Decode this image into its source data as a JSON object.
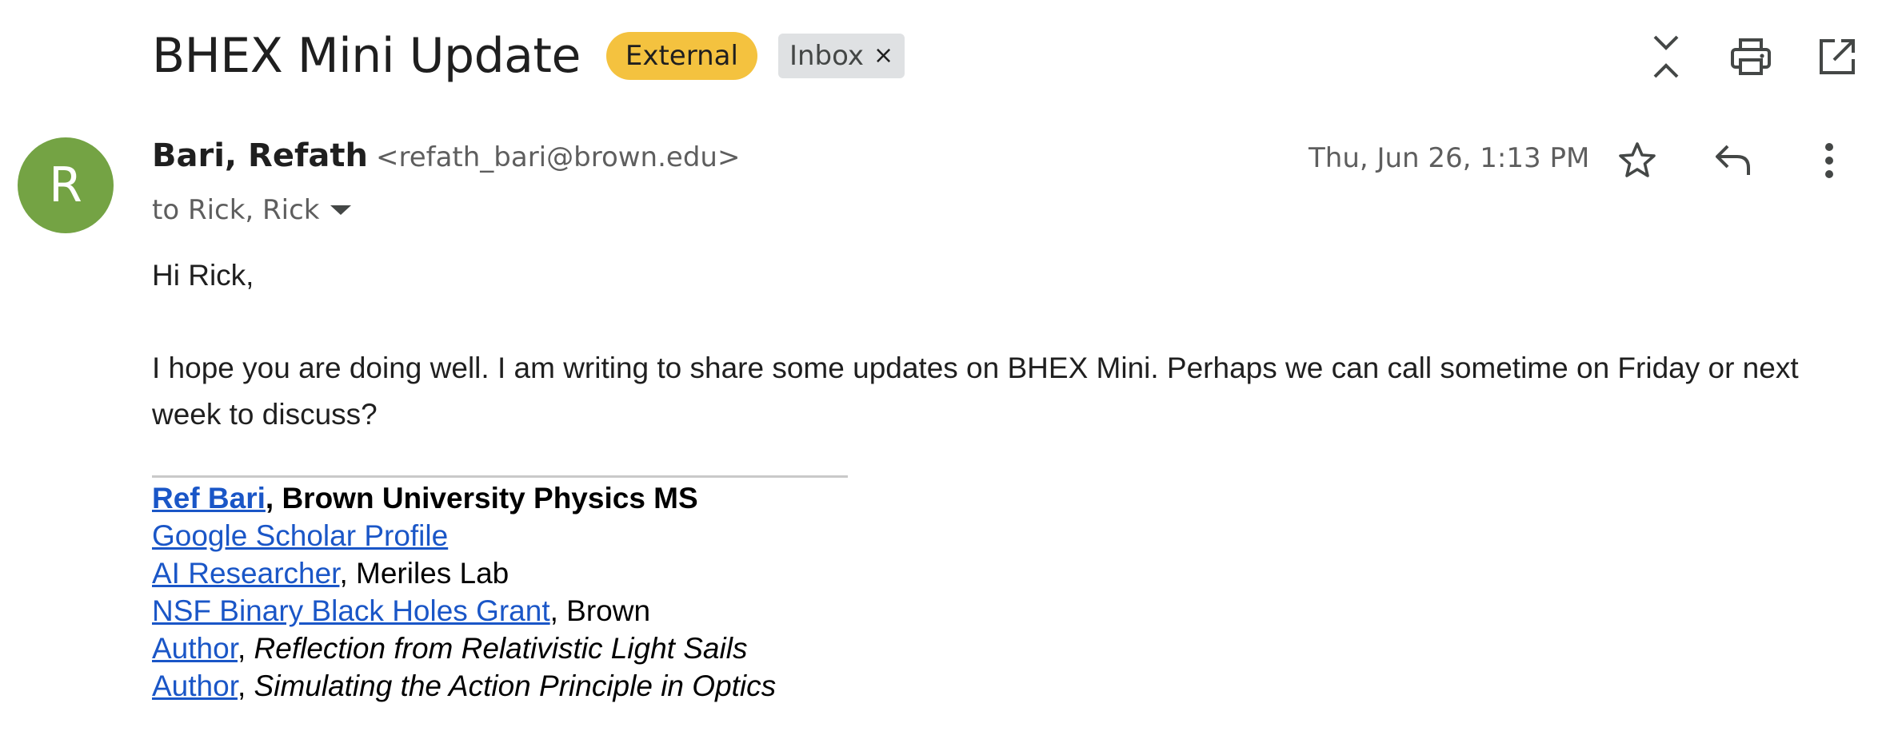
{
  "subject": "BHEX Mini Update",
  "labels": {
    "external": "External",
    "inbox": "Inbox",
    "remove_glyph": "×"
  },
  "top_actions": [
    "collapse-all",
    "print",
    "open-in-new-window"
  ],
  "sender": {
    "avatar_letter": "R",
    "avatar_color": "#74a344",
    "name": "Bari, Refath",
    "email": "<refath_bari@brown.edu>",
    "to": "to Rick, Rick",
    "timestamp": "Thu, Jun 26, 1:13 PM"
  },
  "message_actions": [
    "star",
    "reply",
    "more-options"
  ],
  "body": {
    "greeting": "Hi Rick,",
    "paragraph": "I hope you are doing well. I am writing to share some updates on BHEX Mini. Perhaps we can call sometime on Friday or next week to discuss?"
  },
  "signature": {
    "name_link": "Ref Bari",
    "name_suffix": ", Brown University Physics MS",
    "scholar_link": "Google Scholar Profile",
    "role_link": "AI Researcher",
    "role_suffix": ", Meriles Lab",
    "grant_link": "NSF Binary Black Holes Grant",
    "grant_suffix": ", Brown",
    "author1_link": "Author",
    "author1_sep": ", ",
    "author1_title": "Reflection from Relativistic Light Sails",
    "author2_link": "Author",
    "author2_sep": ", ",
    "author2_title": "Simulating the Action Principle in Optics"
  },
  "colors": {
    "external_label": "#f4c23f",
    "inbox_label": "#dfe1e3",
    "link": "#1a56c7"
  }
}
